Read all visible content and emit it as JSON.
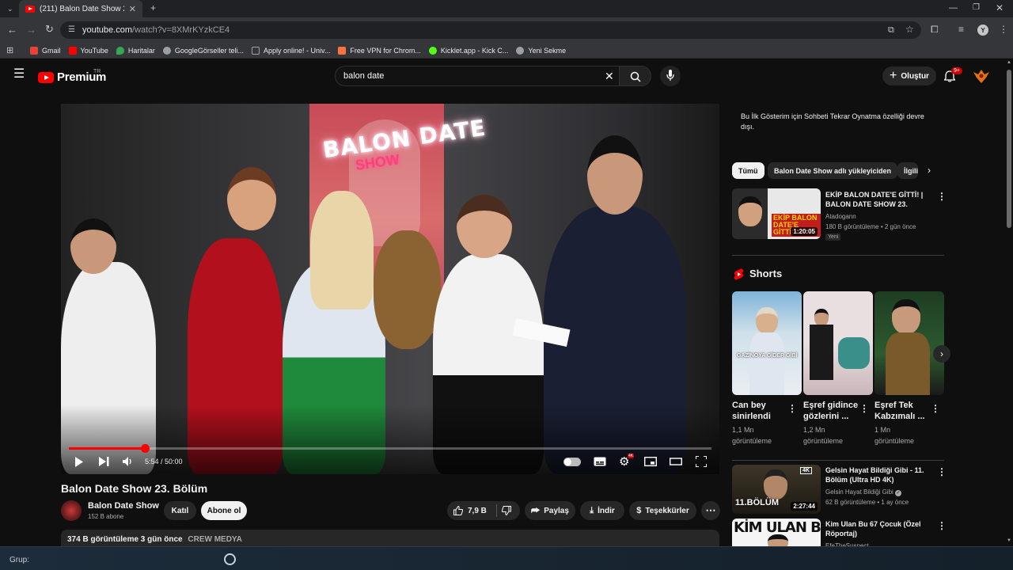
{
  "browser": {
    "tab_title": "(211) Balon Date Show 23. Bölüm",
    "url_host": "youtube.com",
    "url_path": "/watch?v=8XMrKYzkCE4",
    "bookmarks": [
      {
        "label": "Gmail",
        "color": "#ea4335"
      },
      {
        "label": "YouTube",
        "color": "#ff0000"
      },
      {
        "label": "Haritalar",
        "color": "#34a853"
      },
      {
        "label": "GoogleGörseller teli...",
        "color": "#9aa0a6"
      },
      {
        "label": "Apply online! - Univ...",
        "color": "#9aa0a6"
      },
      {
        "label": "Free VPN for Chrom...",
        "color": "#ff7043"
      },
      {
        "label": "Kicklet.app - Kick C...",
        "color": "#53fc18"
      },
      {
        "label": "Yeni Sekme",
        "color": "#9aa0a6"
      }
    ]
  },
  "header": {
    "logo_text": "Premium",
    "logo_region": "TR",
    "search_value": "balon date",
    "create_label": "Oluştur",
    "notif_count": "9+"
  },
  "player": {
    "neon_line1": "BALON DATE",
    "neon_line2": "SHOW",
    "time_display": "5:54 / 50:00",
    "progress_fraction": 0.118
  },
  "video": {
    "title": "Balon Date Show 23. Bölüm",
    "channel_name": "Balon Date Show",
    "channel_subs": "152 B abone",
    "join_label": "Katıl",
    "subscribe_label": "Abone ol",
    "like_count": "7,9 B",
    "share_label": "Paylaş",
    "download_label": "İndir",
    "thanks_label": "Teşekkürler",
    "views_date": "374 B görüntüleme  3 gün önce",
    "tag": "CREW MEDYA"
  },
  "sidebar": {
    "chat_note": "Bu İlk Gösterim için Sohbeti Tekrar Oynatma özelliği devre dışı.",
    "chips": [
      "Tümü",
      "Balon Date Show adlı yükleyiciden",
      "İlgili"
    ],
    "top_video": {
      "title": "EKİP BALON DATE'E GİTTİ! | BALON DATE SHOW 23. BÖLÜ...",
      "channel": "Atadogann",
      "meta": "180 B görüntüleme • 2 gün önce",
      "badge": "Yeni",
      "duration": "1:20:05",
      "thumb_text": "EKİP BALON DATE'E GİTTİ!"
    },
    "shorts_heading": "Shorts",
    "shorts": [
      {
        "title": "Can bey sinirlendi",
        "views": "1,1 Mn görüntüleme",
        "overlay": "GAZİNOYA GİDER GİBİ"
      },
      {
        "title": "Eşref gidince gözlerini ...",
        "views": "1,2 Mn görüntüleme",
        "overlay": ""
      },
      {
        "title": "Eşref Tek Kabzımalı ...",
        "views": "1 Mn görüntüleme",
        "overlay": ""
      }
    ],
    "list": [
      {
        "title": "Gelsin Hayat Bildiği Gibi - 11. Bölüm (Ultra HD 4K)",
        "channel": "Gelsin Hayat Bildiği Gibi",
        "meta": "62 B görüntüleme • 1 ay önce",
        "duration": "2:27:44",
        "thumb_text": "11.BÖLÜM",
        "badge_4k": "4K"
      },
      {
        "title": "Kim Ulan Bu 67 Çocuk (Özel Röportaj)",
        "channel": "EfeTheSuspect",
        "meta": "",
        "duration": "",
        "thumb_text": "KİM ULAN BU"
      }
    ]
  },
  "taskbar": {
    "grup_label": "Grup:"
  },
  "colors": {
    "background": "#0f0f0f",
    "accent_red": "#ff0000",
    "chip_bg": "#272727"
  }
}
